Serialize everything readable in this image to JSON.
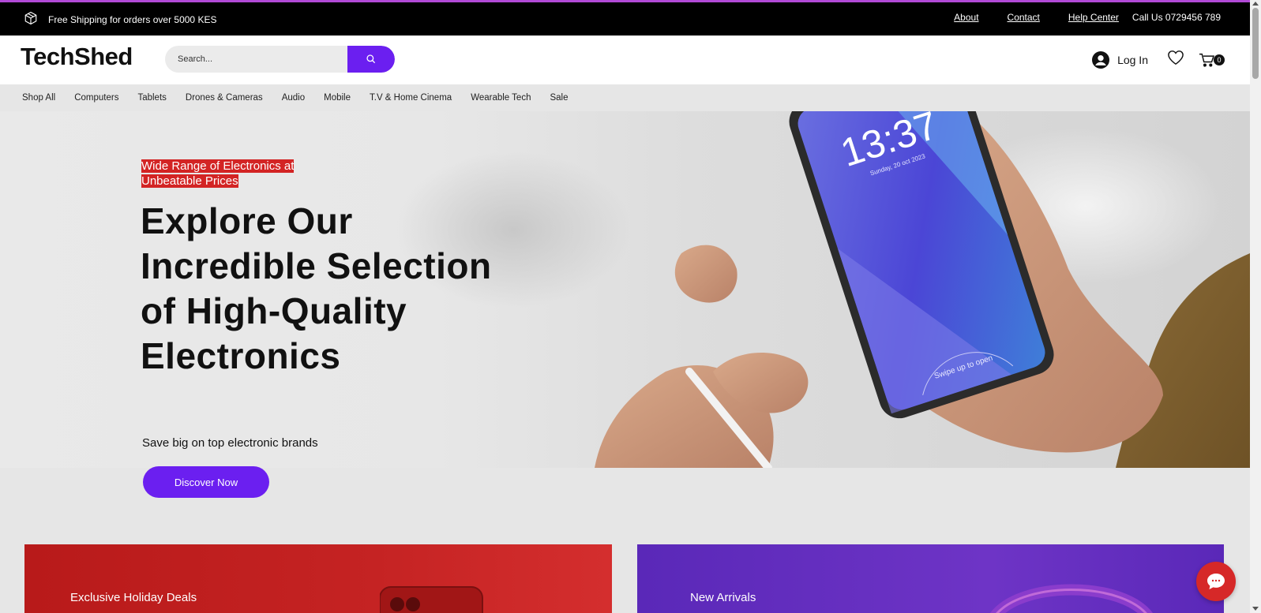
{
  "topbar": {
    "shipping_text": "Free Shipping for orders over 5000 KES",
    "links": [
      "About",
      "Contact",
      "Help Center"
    ],
    "call_text": "Call Us 0729456 789",
    "accent_color": "#b14ad6"
  },
  "header": {
    "logo": "TechShed",
    "search_placeholder": "Search...",
    "login_label": "Log In",
    "cart_count": "0",
    "brand_color": "#6b1ff0"
  },
  "nav": {
    "items": [
      "Shop All",
      "Computers",
      "Tablets",
      "Drones & Cameras",
      "Audio",
      "Mobile",
      "T.V & Home Cinema",
      "Wearable Tech",
      "Sale"
    ]
  },
  "hero": {
    "tagline": "Wide Range of Electronics at Unbeatable Prices",
    "headline": "Explore Our Incredible Selection of High-Quality Electronics",
    "subheadline": "Save big on top electronic brands",
    "cta_label": "Discover Now",
    "phone_time": "13:37",
    "phone_date": "Sunday, 20 oct 2023",
    "phone_unlock": "Swipe up to open"
  },
  "promos": [
    {
      "label": "Exclusive Holiday Deals",
      "color": "#c52323"
    },
    {
      "label": "New Arrivals",
      "color": "#6e34c6"
    }
  ],
  "chat": {
    "icon": "chat-bubble-icon",
    "color": "#d62828"
  }
}
